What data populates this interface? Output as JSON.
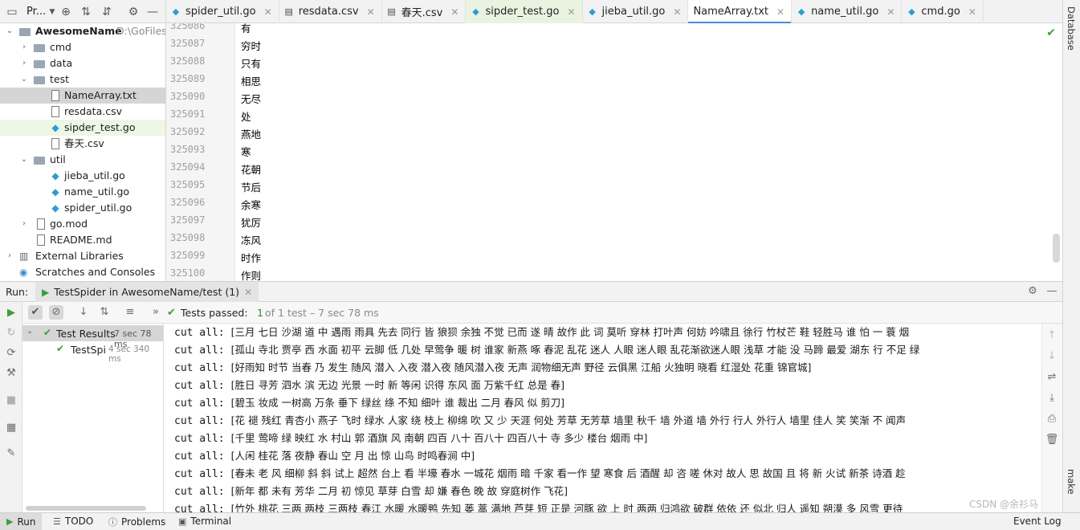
{
  "project_toolbar": {
    "title": "Pr..."
  },
  "tabs": [
    {
      "label": "spider_util.go",
      "kind": "go"
    },
    {
      "label": "resdata.csv",
      "kind": "csv"
    },
    {
      "label": "春天.csv",
      "kind": "csv"
    },
    {
      "label": "sipder_test.go",
      "kind": "go"
    },
    {
      "label": "jieba_util.go",
      "kind": "go"
    },
    {
      "label": "NameArray.txt",
      "kind": "txt"
    },
    {
      "label": "name_util.go",
      "kind": "go"
    },
    {
      "label": "cmd.go",
      "kind": "go"
    }
  ],
  "right_strip": {
    "database_label": "Database",
    "make_label": "make"
  },
  "tree": {
    "root": {
      "name": "AwesomeName",
      "path": "D:\\GoFiles\\"
    },
    "items": [
      {
        "label": "cmd"
      },
      {
        "label": "data"
      },
      {
        "label": "test"
      },
      {
        "label": "NameArray.txt"
      },
      {
        "label": "resdata.csv"
      },
      {
        "label": "sipder_test.go"
      },
      {
        "label": "春天.csv"
      },
      {
        "label": "util"
      },
      {
        "label": "jieba_util.go"
      },
      {
        "label": "name_util.go"
      },
      {
        "label": "spider_util.go"
      },
      {
        "label": "go.mod"
      },
      {
        "label": "README.md"
      },
      {
        "label": "External Libraries"
      },
      {
        "label": "Scratches and Consoles"
      }
    ]
  },
  "editor": {
    "lines": [
      {
        "no": "325086",
        "text": "有"
      },
      {
        "no": "325087",
        "text": "穷时"
      },
      {
        "no": "325088",
        "text": "只有"
      },
      {
        "no": "325089",
        "text": "相思"
      },
      {
        "no": "325090",
        "text": "无尽"
      },
      {
        "no": "325091",
        "text": "处"
      },
      {
        "no": "325092",
        "text": "燕地"
      },
      {
        "no": "325093",
        "text": "寒"
      },
      {
        "no": "325094",
        "text": "花朝"
      },
      {
        "no": "325095",
        "text": "节后"
      },
      {
        "no": "325096",
        "text": "余寒"
      },
      {
        "no": "325097",
        "text": "犹厉"
      },
      {
        "no": "325098",
        "text": "冻风"
      },
      {
        "no": "325099",
        "text": "时作"
      },
      {
        "no": "325100",
        "text": "作则"
      }
    ]
  },
  "run": {
    "label": "Run:",
    "config_tab": "TestSpider in AwesomeName/test (1)",
    "status_prefix": "Tests passed:",
    "status_count": "1",
    "status_suffix": "of 1 test – 7 sec 78 ms",
    "results": [
      {
        "label": "Test Results",
        "time": "7 sec 78 ms"
      },
      {
        "label": "TestSpi",
        "time": "4 sec 340 ms"
      }
    ],
    "console_prefix": "cut all:",
    "console_lines": [
      "[三月 七日 沙湖 道 中 遇雨 雨具 先去 同行 皆 狼狈 余独 不觉 已而 遂 晴 故作 此 词 莫听 穿林 打叶声 何妨 吟啸且 徐行 竹杖芒 鞋 轻胜马 谁 怕 一 蓑 烟",
      "[孤山 寺北 贾亭 西 水面 初平 云脚 低 几处 早莺争 暖 树 谁家 新燕 啄 春泥 乱花 迷人 人眼 迷人眼 乱花渐欲迷人眼 浅草 才能 没 马蹄 最爱 湖东 行 不足 绿",
      "[好雨知 时节 当春 乃 发生 随风 潜入 入夜 潜入夜 随风潜入夜 无声 润物细无声 野径 云俱黑 江船 火独明 晓看 红湿处 花重 锦官城]",
      "[胜日 寻芳 泗水 滨 无边 光景 一时 新 等闲 识得 东风 面 万紫千红 总是 春]",
      "[碧玉 妆成 一树高 万条 垂下 绿丝 绦 不知 细叶 谁 裁出 二月 春风 似 剪刀]",
      "[花 褪 残红 青杏小 燕子 飞时 绿水 人家 绕 枝上 柳绵 吹 又 少 天涯 何处 芳草 无芳草 墙里 秋千 墙 外道 墙 外行 行人 外行人 墙里 佳人 笑 笑渐 不 闻声",
      "[千里 莺啼 绿 映红 水 村山 郭 酒旗 风 南朝 四百 八十 百八十 四百八十 寺 多少 楼台 烟雨 中]",
      "[人闲 桂花 落 夜静 春山 空 月 出 惊 山鸟 时鸣春涧 中]",
      "[春未 老 风 细柳 斜 斜 试上 超然 台上 看 半壕 春水 一城花 烟雨 暗 千家 看一作 望 寒食 后 酒醒 却 咨 嗟 休对 故人 思 故国 且 将 新 火试 新茶 诗酒 趁",
      "[新年 都 未有 芳华 二月 初 惊见 草芽 白雪 却 嫌 春色 晚 故 穿庭树作 飞花]",
      "[竹外 桃花 三两 两枝 三两枝 春江 水暖 水暖鸭 先知 蒌 蒿 满地 芦芽 短 正是 河豚 欲 上 时 两两 归鸿欲 破群 依依 还 似北 归人 遥知 朔漠 多 风雪 更待"
    ]
  },
  "watermark": "CSDN @余衫马",
  "bottom": {
    "run": "Run",
    "todo": "TODO",
    "problems": "Problems",
    "terminal": "Terminal",
    "event_log": "Event Log"
  },
  "colors": {
    "accent": "#4a8bd6",
    "pass_green": "#3c9e3c",
    "go_icon": "#2c9cd6",
    "selection": "#d5d5d5"
  }
}
